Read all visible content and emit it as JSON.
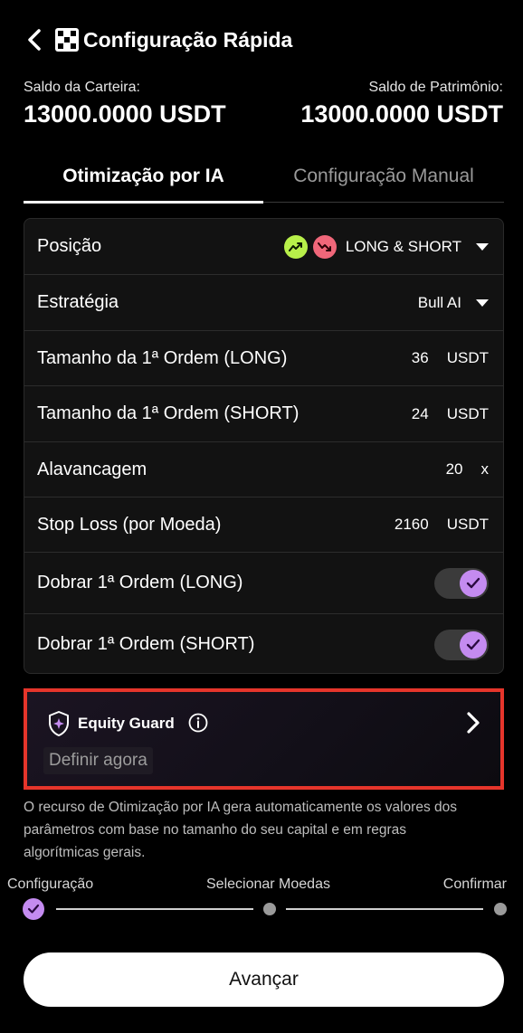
{
  "header": {
    "title": "Configuração Rápida",
    "back_icon": "chevron-left-icon",
    "logo_icon": "okx-logo-icon"
  },
  "balances": {
    "wallet_label": "Saldo da Carteira:",
    "wallet_value": "13000.0000 USDT",
    "equity_label": "Saldo de Patrimônio:",
    "equity_value": "13000.0000 USDT"
  },
  "tabs": [
    {
      "label": "Otimização por IA",
      "active": true
    },
    {
      "label": "Configuração Manual",
      "active": false
    }
  ],
  "settings": {
    "position": {
      "label": "Posição",
      "value": "LONG & SHORT"
    },
    "strategy": {
      "label": "Estratégia",
      "value": "Bull AI"
    },
    "first_order_long": {
      "label": "Tamanho da 1ª Ordem (LONG)",
      "value": "36",
      "unit": "USDT"
    },
    "first_order_short": {
      "label": "Tamanho da 1ª Ordem (SHORT)",
      "value": "24",
      "unit": "USDT"
    },
    "leverage": {
      "label": "Alavancagem",
      "value": "20",
      "unit": "x"
    },
    "stop_loss": {
      "label": "Stop Loss (por Moeda)",
      "value": "2160",
      "unit": "USDT"
    },
    "double_long": {
      "label": "Dobrar 1ª Ordem (LONG)",
      "enabled": true
    },
    "double_short": {
      "label": "Dobrar 1ª Ordem (SHORT)",
      "enabled": true
    }
  },
  "equity_guard": {
    "title": "Equity Guard",
    "subtitle": "Definir agora"
  },
  "description": "O recurso de Otimização por IA gera automaticamente os valores dos parâmetros com base no tamanho do seu capital e em regras algorítmicas gerais.",
  "stepper": {
    "steps": [
      {
        "label": "Configuração",
        "done": true
      },
      {
        "label": "Selecionar Moedas",
        "done": false
      },
      {
        "label": "Confirmar",
        "done": false
      }
    ]
  },
  "cta": {
    "label": "Avançar"
  },
  "colors": {
    "background": "#000000",
    "accent_purple": "#c48bf0",
    "long_green": "#b8f04a",
    "short_red": "#f0677a",
    "highlight_red": "#e6352b"
  }
}
